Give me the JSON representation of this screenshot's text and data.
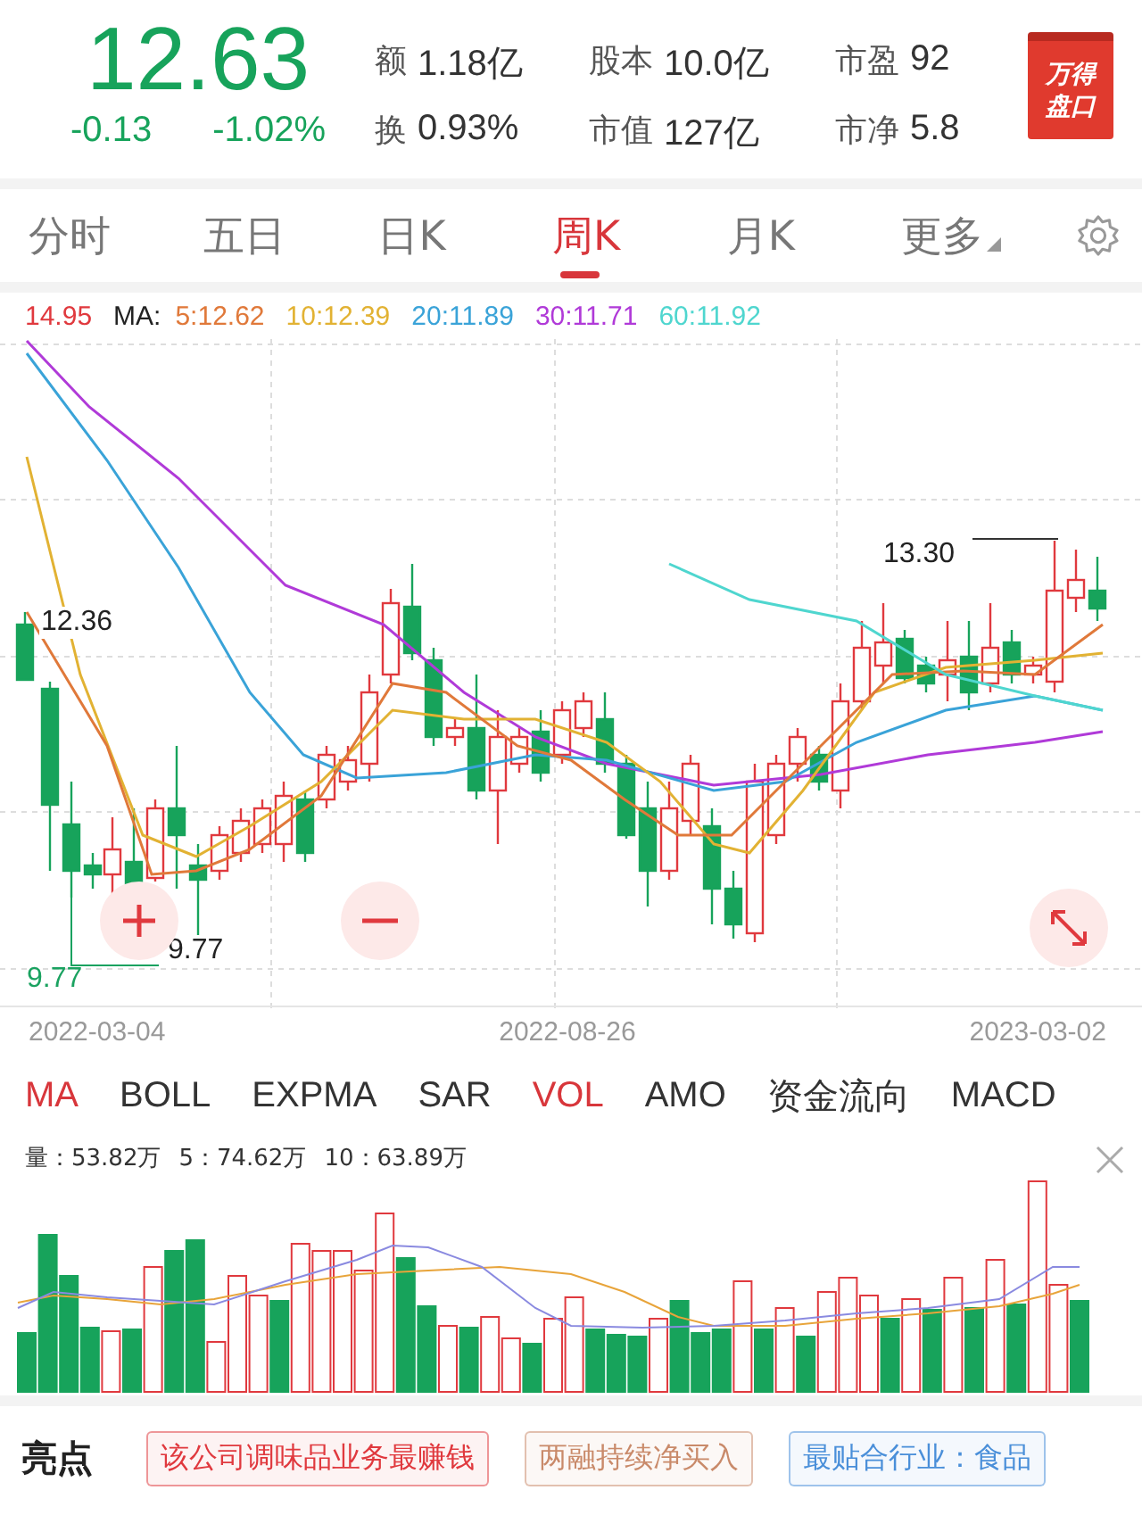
{
  "quote": {
    "price": "12.63",
    "change": "-0.13",
    "change_pct": "-1.02%"
  },
  "stats": [
    {
      "label": "额",
      "value": "1.18亿"
    },
    {
      "label": "股本",
      "value": "10.0亿"
    },
    {
      "label": "市盈",
      "value": "92"
    },
    {
      "label": "换",
      "value": "0.93%"
    },
    {
      "label": "市值",
      "value": "127亿"
    },
    {
      "label": "市净",
      "value": "5.8"
    }
  ],
  "badge": {
    "lines": [
      "万得",
      "盘口"
    ]
  },
  "period_tabs": [
    {
      "label": "分时",
      "selected": false,
      "kind": "tab"
    },
    {
      "label": "五日",
      "selected": false,
      "kind": "tab"
    },
    {
      "label": "日K",
      "selected": false,
      "kind": "tab"
    },
    {
      "label": "周K",
      "selected": true,
      "kind": "tab"
    },
    {
      "label": "月K",
      "selected": false,
      "kind": "tab"
    },
    {
      "label": "更多",
      "selected": false,
      "kind": "menu"
    }
  ],
  "ma_legend": {
    "high": "14.95",
    "label": "MA:",
    "items": [
      {
        "text": "5:12.62",
        "color": "#e0793a"
      },
      {
        "text": "10:12.39",
        "color": "#e2b233"
      },
      {
        "text": "20:11.89",
        "color": "#3aa3d8"
      },
      {
        "text": "30:11.71",
        "color": "#b03ad8"
      },
      {
        "text": "60:11.92",
        "color": "#4fd6cf"
      }
    ]
  },
  "chart": {
    "annotations": [
      {
        "kind": "high",
        "text": "13.30"
      },
      {
        "kind": "left",
        "text": "12.36"
      },
      {
        "kind": "low",
        "text": "9.77"
      },
      {
        "kind": "axis-low",
        "text": "9.77"
      }
    ],
    "dates": [
      "2022-03-04",
      "2022-08-26",
      "2023-03-02"
    ]
  },
  "indicator_tabs": [
    {
      "label": "MA",
      "selected": true
    },
    {
      "label": "BOLL",
      "selected": false
    },
    {
      "label": "EXPMA",
      "selected": false
    },
    {
      "label": "SAR",
      "selected": false
    },
    {
      "label": "VOL",
      "selected": true
    },
    {
      "label": "AMO",
      "selected": false
    },
    {
      "label": "资金流向",
      "selected": false
    },
    {
      "label": "MACD",
      "selected": false
    }
  ],
  "volume_legend": [
    "量：53.82万",
    "5：74.62万",
    "10：63.89万"
  ],
  "highlights": {
    "title": "亮点",
    "tags": [
      {
        "text": "该公司调味品业务最赚钱",
        "color": "#e0393e"
      },
      {
        "text": "两融持续净买入",
        "color": "#c98a6a"
      },
      {
        "text": "最贴合行业：食品",
        "color": "#4a8fd9"
      }
    ]
  }
}
